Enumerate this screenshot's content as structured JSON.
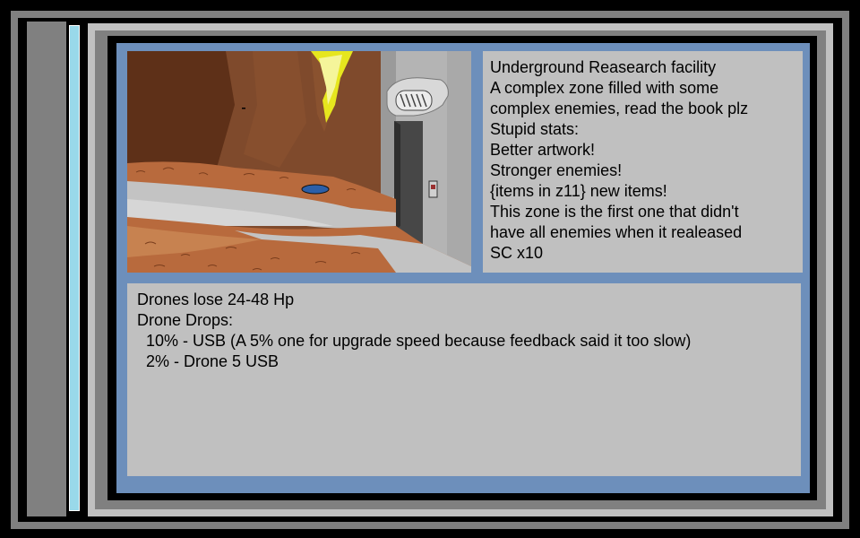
{
  "zone_info": {
    "lines": [
      "Underground Reasearch facility",
      "A complex zone filled with some",
      "complex enemies, read the book plz",
      "Stupid stats:",
      "Better artwork!",
      "Stronger enemies!",
      "{items in z11} new items!",
      "This zone is the first one that didn't",
      "have all enemies when it realeased",
      "SC x10"
    ]
  },
  "drops_info": {
    "lines": [
      "Drones lose 24-48 Hp",
      "Drone Drops:",
      "  10% - USB (A 5% one for upgrade speed because feedback said it too slow)",
      "  2% - Drone 5 USB"
    ]
  },
  "zone_image": {
    "alt": ""
  },
  "colors": {
    "frame_gray": "#808080",
    "panel_light": "#c0c0c0",
    "inner_blue": "#6d8fbb",
    "scrollbar_cyan": "#99d9ea",
    "cave_brown": "#7f4a2c",
    "floor_orange": "#b86a3d",
    "path_gray": "#c3c3c3",
    "elevator_gray": "#b4b4b4",
    "crystal_yellow": "#e6e61e"
  }
}
